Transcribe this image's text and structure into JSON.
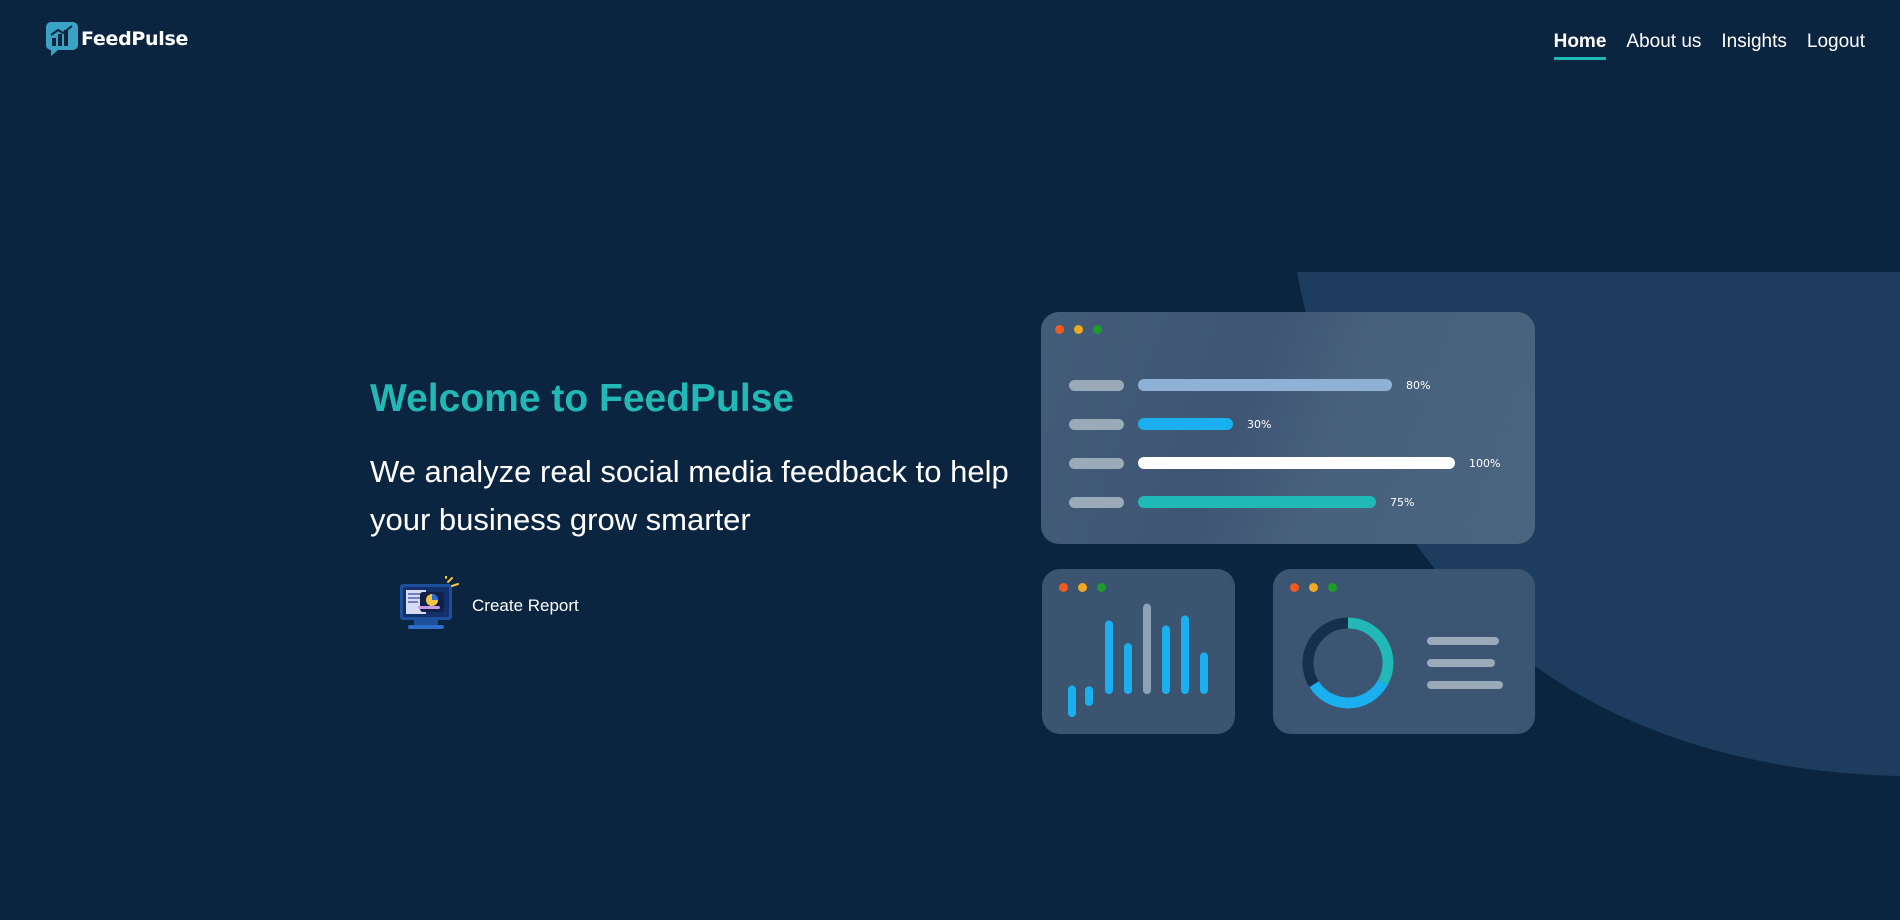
{
  "brand": {
    "name": "FeedPulse",
    "logo_icon": "chat-chart-icon"
  },
  "nav": {
    "items": [
      {
        "label": "Home",
        "active": true
      },
      {
        "label": "About us",
        "active": false
      },
      {
        "label": "Insights",
        "active": false
      },
      {
        "label": "Logout",
        "active": false
      }
    ]
  },
  "hero": {
    "title": "Welcome to FeedPulse",
    "subtitle": "We analyze real social media feedback to help your business grow smarter",
    "cta_label": "Create Report",
    "cta_icon": "report-monitor-icon"
  },
  "colors": {
    "background": "#0b2541",
    "accent": "#22b8b5",
    "blue": "#1ab0f0",
    "light_blue": "#8fb1d6",
    "white": "#ffffff",
    "dot_red": "#f05a1e",
    "dot_yellow": "#f0a81e",
    "dot_green": "#1d9c2b"
  },
  "dashboard": {
    "progress_bars": [
      {
        "label": "80%",
        "value": 0.8,
        "color": "#8fb1d6"
      },
      {
        "label": "30%",
        "value": 0.3,
        "color": "#1ab0f0"
      },
      {
        "label": "100%",
        "value": 1.0,
        "color": "#ffffff"
      },
      {
        "label": "75%",
        "value": 0.75,
        "color": "#1fb9b6"
      }
    ],
    "mini_bar_chart": {
      "values": [
        0.28,
        0.14,
        0.78,
        0.51,
        0.98,
        0.72,
        0.84,
        0.4
      ],
      "colors": [
        "#1ab0f0",
        "#1ab0f0",
        "#1ab0f0",
        "#1ab0f0",
        "#8fa3b8",
        "#1ab0f0",
        "#1ab0f0",
        "#1ab0f0"
      ]
    },
    "donut": {
      "teal_fraction": 0.33,
      "blue_fraction": 0.33,
      "rest_color": "#14304c"
    }
  }
}
